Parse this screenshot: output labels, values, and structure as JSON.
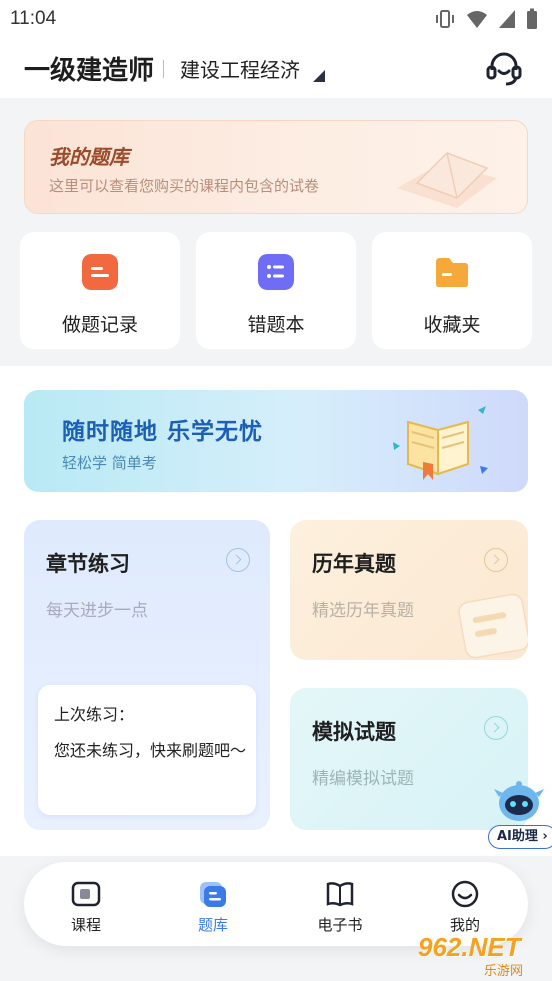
{
  "status_bar": {
    "time": "11:04"
  },
  "header": {
    "title": "一级建造师",
    "subject": "建设工程经济"
  },
  "my_bank": {
    "title": "我的题库",
    "subtitle": "这里可以查看您购买的课程内包含的试卷"
  },
  "tiles": [
    {
      "label": "做题记录",
      "icon": "record-icon",
      "color": "#f2693f"
    },
    {
      "label": "错题本",
      "icon": "wrong-book-icon",
      "color": "#6f6cf5"
    },
    {
      "label": "收藏夹",
      "icon": "folder-icon",
      "color": "#f6a93b"
    }
  ],
  "promo": {
    "title": "随时随地  乐学无忧",
    "subtitle": "轻松学 简单考"
  },
  "cards": {
    "chapter": {
      "title": "章节练习",
      "subtitle": "每天进步一点",
      "last_label": "上次练习：",
      "last_desc": "您还未练习，快来刷题吧～"
    },
    "past": {
      "title": "历年真题",
      "subtitle": "精选历年真题"
    },
    "mock": {
      "title": "模拟试题",
      "subtitle": "精编模拟试题"
    }
  },
  "ai_helper": {
    "label": "AI助理 ›"
  },
  "tabbar": [
    {
      "label": "课程",
      "icon": "course-icon",
      "active": false
    },
    {
      "label": "题库",
      "icon": "question-bank-icon",
      "active": true
    },
    {
      "label": "电子书",
      "icon": "ebook-icon",
      "active": false
    },
    {
      "label": "我的",
      "icon": "profile-icon",
      "active": false
    }
  ],
  "watermark": {
    "number": "962.NET",
    "text": "乐游网"
  },
  "colors": {
    "accent": "#3b7be8",
    "bank_title": "#9b4a2a",
    "promo_title": "#1d5fb4"
  }
}
